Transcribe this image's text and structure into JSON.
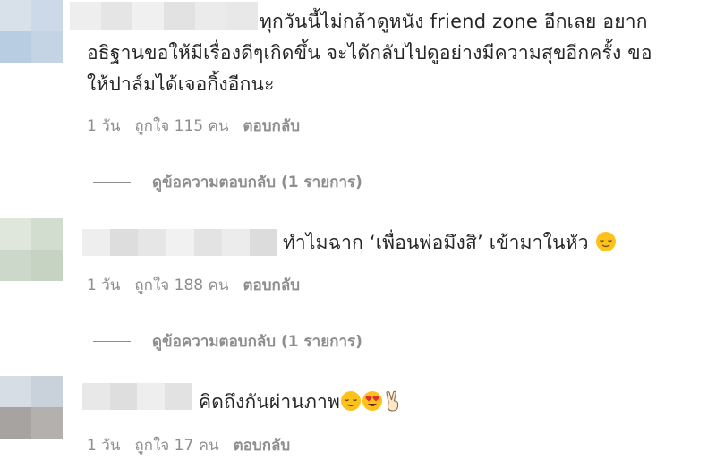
{
  "comments": [
    {
      "text_lines": [
        "ทุกวันนี้ไม่กล้าดูหนัง friend zone อีกเลย อยาก",
        "อธิฐานขอให้มีเรื่องดีๆเกิดขึ้น จะได้กลับไปดูอย่างมีความสุขอีกครั้ง ขอ",
        "ให้ปาล์มได้เจอกิ้งอีกนะ"
      ],
      "time": "1 วัน",
      "likes": "ถูกใจ 115 คน",
      "reply": "ตอบกลับ",
      "view_replies": "ดูข้อความตอบกลับ (1 รายการ)"
    },
    {
      "text": "ทำไมฉาก ‘เพื่อนพ่อมึงสิ’ เข้ามาในหัว",
      "time": "1 วัน",
      "likes": "ถูกใจ 188 คน",
      "reply": "ตอบกลับ",
      "view_replies": "ดูข้อความตอบกลับ (1 รายการ)"
    },
    {
      "text": "คิดถึงกันผ่านภาพ",
      "time": "1 วัน",
      "likes": "ถูกใจ 17 คน",
      "reply": "ตอบกลับ"
    }
  ],
  "icons": [
    "relieved-face-icon",
    "heart-eyes-face-icon",
    "victory-hand-icon"
  ],
  "colors": {
    "text": "#262626",
    "meta": "#8e8e8e",
    "background": "#ffffff"
  }
}
